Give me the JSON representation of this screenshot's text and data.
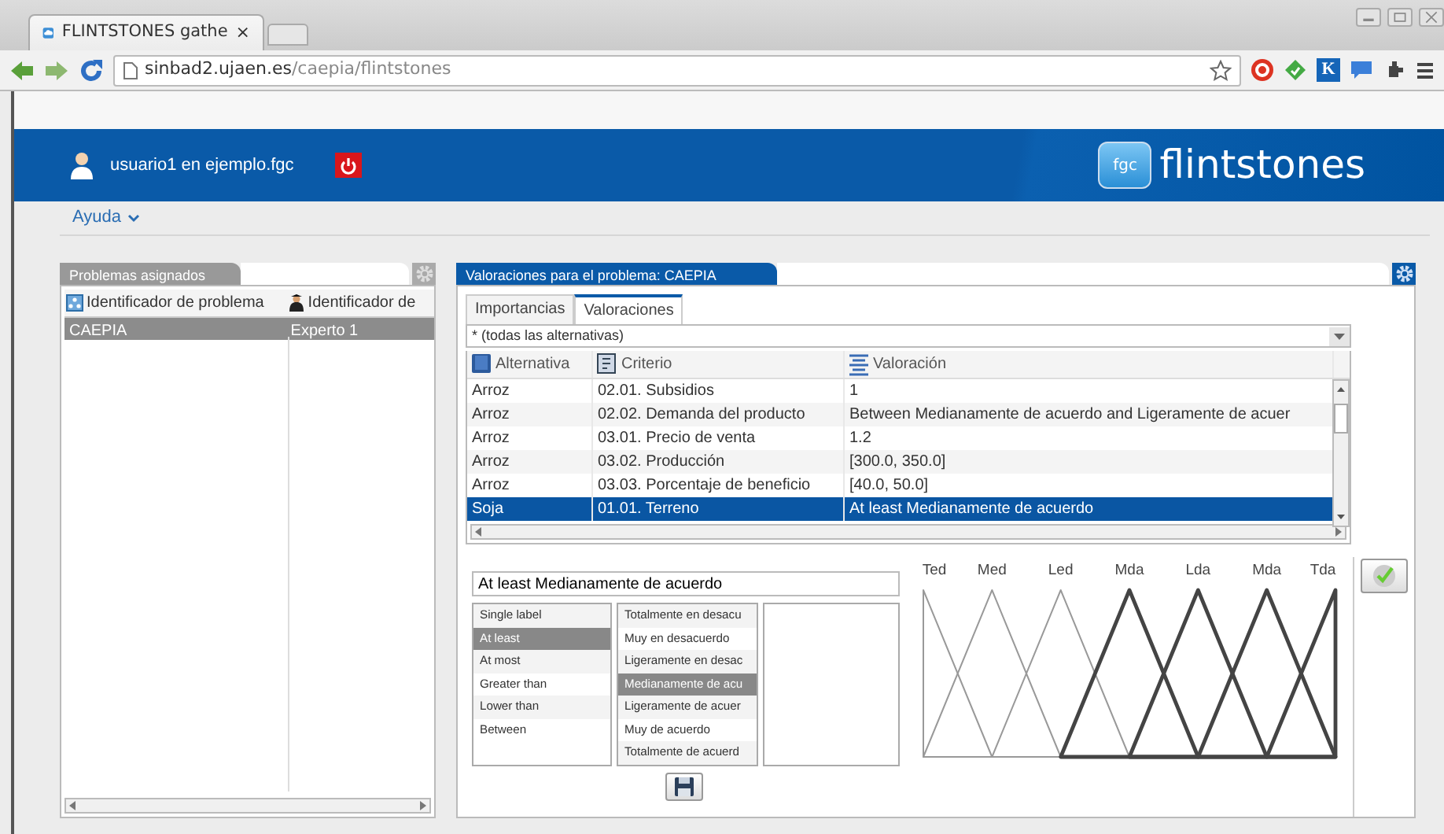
{
  "browser": {
    "tab_title": "FLINTSTONES gathe",
    "tab_close": "×",
    "url_host": "sinbad2.ujaen.es",
    "url_path": "/caepia/flintstones",
    "extension_letter": "K"
  },
  "header": {
    "user": "usuario1 en ejemplo.fgc",
    "logo_badge": "fgc",
    "logo_name": "flintstones"
  },
  "menu": [
    {
      "label": "Ayuda"
    }
  ],
  "left_panel": {
    "title": "Problemas asignados",
    "columns": [
      "Identificador de problema",
      "Identificador de"
    ],
    "rows": [
      {
        "cells": [
          "CAEPIA",
          "Experto 1"
        ],
        "selected": true
      }
    ]
  },
  "right_panel": {
    "title": "Valoraciones para el problema: CAEPIA",
    "tabs": [
      {
        "label": "Importancias",
        "selected": false
      },
      {
        "label": "Valoraciones",
        "selected": true
      }
    ],
    "filter": "* (todas las alternativas)",
    "columns": [
      "Alternativa",
      "Criterio",
      "Valoración"
    ],
    "rows": [
      {
        "cells": [
          "Arroz",
          "02.01. Subsidios",
          "1"
        ],
        "selected": false
      },
      {
        "cells": [
          "Arroz",
          "02.02. Demanda del producto",
          "Between Medianamente de acuerdo and Ligeramente de acuer"
        ],
        "selected": false
      },
      {
        "cells": [
          "Arroz",
          "03.01. Precio de venta",
          "1.2"
        ],
        "selected": false
      },
      {
        "cells": [
          "Arroz",
          "03.02. Producción",
          "[300.0, 350.0]"
        ],
        "selected": false
      },
      {
        "cells": [
          "Arroz",
          "03.03. Porcentaje de beneficio",
          "[40.0, 50.0]"
        ],
        "selected": false
      },
      {
        "cells": [
          "Soja",
          "01.01. Terreno",
          "At least Medianamente de acuerdo"
        ],
        "selected": true
      }
    ],
    "expression": "At least Medianamente de acuerdo",
    "expression_types": [
      {
        "label": "Single label",
        "selected": false
      },
      {
        "label": "At least",
        "selected": true
      },
      {
        "label": "At most",
        "selected": false
      },
      {
        "label": "Greater than",
        "selected": false
      },
      {
        "label": "Lower than",
        "selected": false
      },
      {
        "label": "Between",
        "selected": false
      }
    ],
    "linguistic_labels": [
      {
        "label": "Totalmente en desacu",
        "selected": false
      },
      {
        "label": "Muy en desacuerdo",
        "selected": false
      },
      {
        "label": "Ligeramente en desac",
        "selected": false
      },
      {
        "label": "Medianamente de acu",
        "selected": true
      },
      {
        "label": "Ligeramente de acuer",
        "selected": false
      },
      {
        "label": "Muy de acuerdo",
        "selected": false
      },
      {
        "label": "Totalmente de acuerd",
        "selected": false
      }
    ],
    "partition": [
      {
        "label": "Ted",
        "highlighted": false
      },
      {
        "label": "Med",
        "highlighted": false
      },
      {
        "label": "Led",
        "highlighted": false
      },
      {
        "label": "Mda",
        "highlighted": true
      },
      {
        "label": "Lda",
        "highlighted": true
      },
      {
        "label": "Mda",
        "highlighted": true
      },
      {
        "label": "Tda",
        "highlighted": true
      }
    ]
  }
}
